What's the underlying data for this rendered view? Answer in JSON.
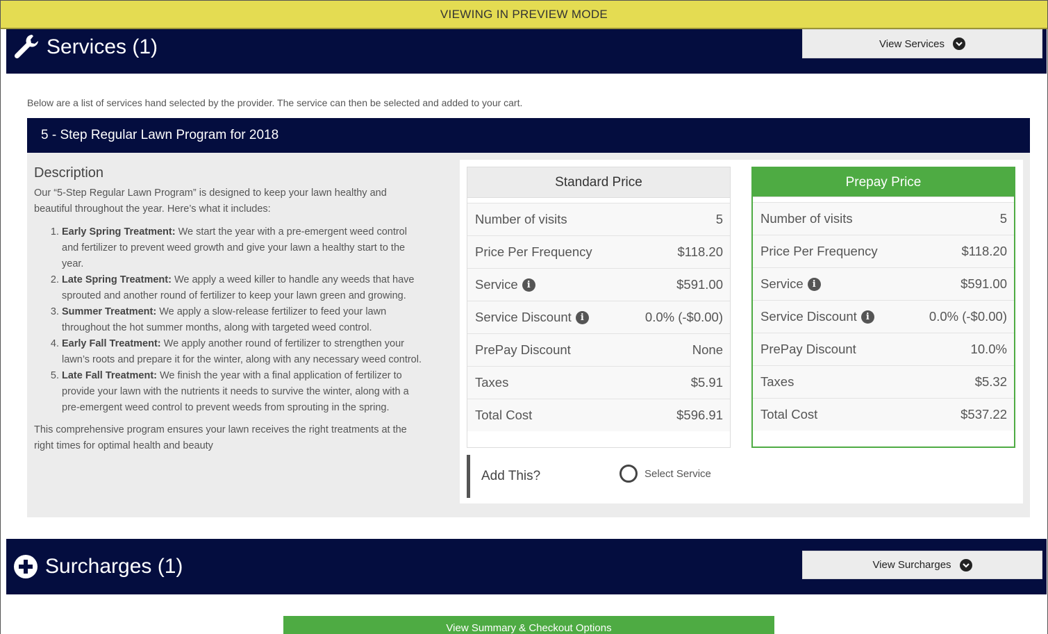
{
  "preview_banner": "VIEWING IN PREVIEW MODE",
  "services_section": {
    "title": "Services (1)",
    "icon": "wrench-icon",
    "view_button": "View Services"
  },
  "intro_text": "Below are a list of services hand selected by the provider. The service can then be selected and added to your cart.",
  "program": {
    "title": "5 - Step Regular Lawn Program for 2018",
    "description_heading": "Description",
    "description_intro": "Our “5-Step Regular Lawn Program” is designed to keep your lawn healthy and beautiful throughout the year. Here’s what it includes:",
    "steps": [
      {
        "title": "Early Spring Treatment:",
        "text": " We start the year with a pre-emergent weed control and fertilizer to prevent weed growth and give your lawn a healthy start to the year."
      },
      {
        "title": "Late Spring Treatment:",
        "text": " We apply a weed killer to handle any weeds that have sprouted and another round of fertilizer to keep your lawn green and growing."
      },
      {
        "title": "Summer Treatment:",
        "text": " We apply a slow-release fertilizer to feed your lawn throughout the hot summer months, along with targeted weed control."
      },
      {
        "title": "Early Fall Treatment:",
        "text": " We apply another round of fertilizer to strengthen your lawn’s roots and prepare it for the winter, along with any necessary weed control."
      },
      {
        "title": "Late Fall Treatment:",
        "text": " We finish the year with a final application of fertilizer to provide your lawn with the nutrients it needs to survive the winter, along with a pre-emergent weed control to prevent weeds from sprouting in the spring."
      }
    ],
    "description_outro": "This comprehensive program ensures your lawn receives the right treatments at the right times for optimal health and beauty"
  },
  "standard_price": {
    "title": "Standard Price",
    "rows": [
      {
        "label": "Number of visits",
        "value": "5"
      },
      {
        "label": "Price Per Frequency",
        "value": "$118.20"
      },
      {
        "label": "Service",
        "value": "$591.00"
      },
      {
        "label": "Service Discount",
        "value": "0.0% (-$0.00)"
      },
      {
        "label": "PrePay Discount",
        "value": "None"
      },
      {
        "label": "Taxes",
        "value": "$5.91"
      },
      {
        "label": "Total Cost",
        "value": "$596.91"
      }
    ]
  },
  "prepay_price": {
    "title": "Prepay Price",
    "rows": [
      {
        "label": "Number of visits",
        "value": "5"
      },
      {
        "label": "Price Per Frequency",
        "value": "$118.20"
      },
      {
        "label": "Service",
        "value": "$591.00"
      },
      {
        "label": "Service Discount",
        "value": "0.0% (-$0.00)"
      },
      {
        "label": "PrePay Discount",
        "value": "10.0%"
      },
      {
        "label": "Taxes",
        "value": "$5.32"
      },
      {
        "label": "Total Cost",
        "value": "$537.22"
      }
    ]
  },
  "add_this": {
    "label": "Add This?",
    "option_label": "Select Service"
  },
  "surcharges_section": {
    "title": "Surcharges (1)",
    "icon": "plus-circle-icon",
    "view_button": "View Surcharges"
  },
  "checkout_button": "View Summary & Checkout Options",
  "colors": {
    "navy": "#040d3f",
    "green": "#4eab43",
    "preview_yellow": "#e4dc52"
  }
}
